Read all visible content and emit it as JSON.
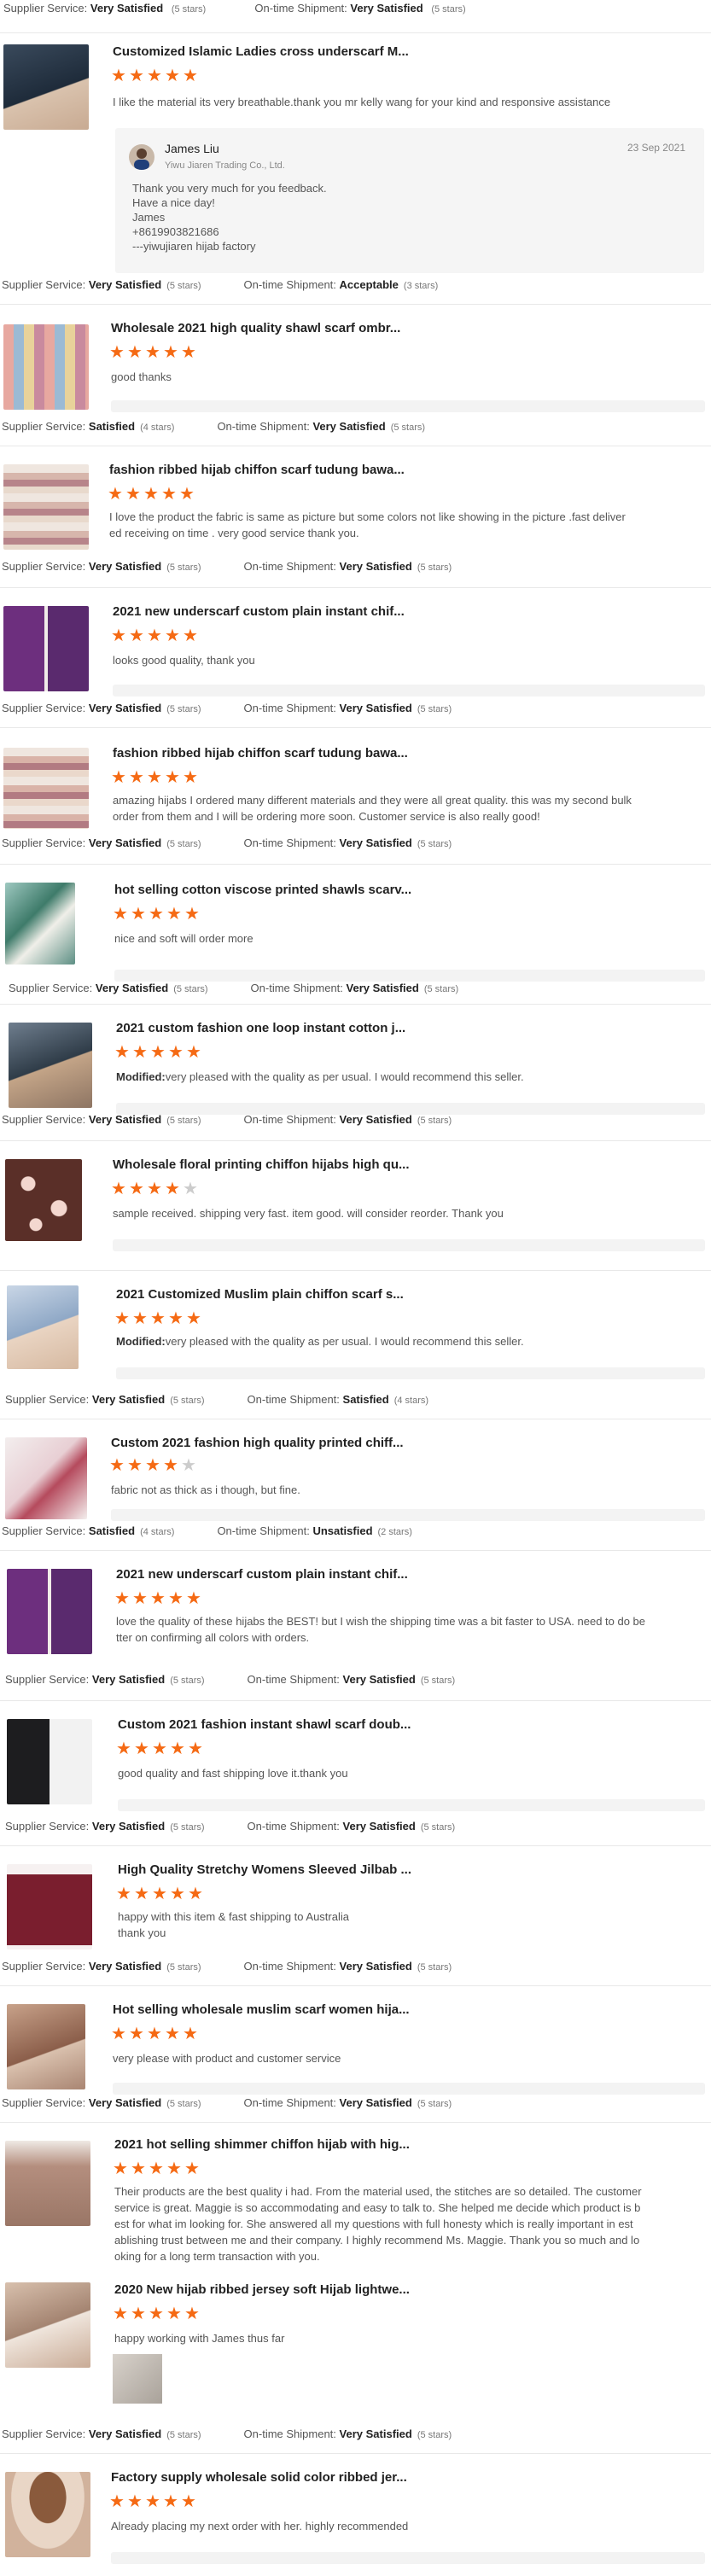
{
  "labels": {
    "supplier": "Supplier Service:",
    "ontime": "On-time Shipment:"
  },
  "colors": {
    "star": "#f56a14",
    "star_off": "#cccccc"
  },
  "top_stats": {
    "supplier_value": "Very Satisfied",
    "supplier_stars": "(5 stars)",
    "ontime_value": "Very Satisfied",
    "ontime_stars": "(5 stars)"
  },
  "reviews": [
    {
      "title": "Customized Islamic Ladies cross underscarf M...",
      "rating": 5,
      "text": "I like the material its very breathable.thank you mr kelly wang for your kind and responsive assistance",
      "reply": {
        "name": "James Liu",
        "company": "Yiwu Jiaren Trading Co., Ltd.",
        "date": "23 Sep 2021",
        "lines": [
          "Thank you very much for you feedback.",
          "Have a nice day!",
          "James",
          "+8619903821686",
          "---yiwujiaren hijab factory"
        ]
      },
      "supplier_value": "Very Satisfied",
      "supplier_stars": "(5 stars)",
      "ontime_value": "Acceptable",
      "ontime_stars": "(3 stars)"
    },
    {
      "title": "Wholesale 2021 high quality shawl scarf ombr...",
      "rating": 5,
      "text": "good thanks",
      "supplier_value": "Satisfied",
      "supplier_stars": "(4 stars)",
      "ontime_value": "Very Satisfied",
      "ontime_stars": "(5 stars)"
    },
    {
      "title": "fashion ribbed hijab chiffon scarf tudung bawa...",
      "rating": 5,
      "text_lines": [
        "I love the product the fabric is same as picture but some colors not  like showing in the picture .fast deliver",
        "ed receiving on time . very good service thank you."
      ],
      "supplier_value": "Very Satisfied",
      "supplier_stars": "(5 stars)",
      "ontime_value": "Very Satisfied",
      "ontime_stars": "(5 stars)"
    },
    {
      "title": "2021 new underscarf custom plain instant chif...",
      "rating": 5,
      "text": "looks good quality, thank you",
      "supplier_value": "Very Satisfied",
      "supplier_stars": "(5 stars)",
      "ontime_value": "Very Satisfied",
      "ontime_stars": "(5 stars)"
    },
    {
      "title": "fashion ribbed hijab chiffon scarf tudung bawa...",
      "rating": 5,
      "text_lines": [
        "amazing hijabs I ordered many different materials and they were all great quality. this was my second bulk",
        "order from them and I will be ordering more soon. Customer service is also really good!"
      ],
      "supplier_value": "Very Satisfied",
      "supplier_stars": "(5 stars)",
      "ontime_value": "Very Satisfied",
      "ontime_stars": "(5 stars)"
    },
    {
      "title": "hot selling cotton viscose printed shawls scarv...",
      "rating": 5,
      "text": "nice and soft will order more",
      "supplier_value": "Very Satisfied",
      "supplier_stars": "(5 stars)",
      "ontime_value": "Very Satisfied",
      "ontime_stars": "(5 stars)"
    },
    {
      "title": "2021 custom fashion one loop instant cotton j...",
      "rating": 5,
      "modified_label": "Modified:",
      "text": "very pleased with the quality as per usual. I would recommend this seller.",
      "supplier_value": "Very Satisfied",
      "supplier_stars": "(5 stars)",
      "ontime_value": "Very Satisfied",
      "ontime_stars": "(5 stars)"
    },
    {
      "title": "Wholesale floral printing chiffon hijabs high qu...",
      "rating": 4,
      "text": "sample received. shipping very fast. item good. will consider reorder. Thank you"
    },
    {
      "title": "2021 Customized Muslim plain chiffon scarf s...",
      "rating": 5,
      "modified_label": "Modified:",
      "text": "very pleased with the quality as per usual. I would recommend this seller.",
      "supplier_value": "Very Satisfied",
      "supplier_stars": "(5 stars)",
      "ontime_value": "Satisfied",
      "ontime_stars": "(4 stars)"
    },
    {
      "title": "Custom 2021 fashion high quality printed chiff...",
      "rating": 4,
      "text": "fabric not as thick as i though, but fine.",
      "supplier_value": "Satisfied",
      "supplier_stars": "(4 stars)",
      "ontime_value": "Unsatisfied",
      "ontime_stars": "(2 stars)"
    },
    {
      "title": "2021 new underscarf custom plain instant chif...",
      "rating": 5,
      "text_lines": [
        "love the quality of these hijabs the BEST! but I wish the shipping time was a bit faster to USA. need to do be",
        "tter on confirming all colors with orders."
      ],
      "supplier_value": "Very Satisfied",
      "supplier_stars": "(5 stars)",
      "ontime_value": "Very Satisfied",
      "ontime_stars": "(5 stars)"
    },
    {
      "title": "Custom 2021 fashion instant shawl scarf doub...",
      "rating": 5,
      "text": "good  quality  and  fast shipping  love it.thank you",
      "supplier_value": "Very Satisfied",
      "supplier_stars": "(5 stars)",
      "ontime_value": "Very Satisfied",
      "ontime_stars": "(5 stars)"
    },
    {
      "title": "High Quality Stretchy Womens Sleeved Jilbab ...",
      "rating": 5,
      "text_lines": [
        "happy with this item & fast shipping to Australia",
        "thank you"
      ],
      "supplier_value": "Very Satisfied",
      "supplier_stars": "(5 stars)",
      "ontime_value": "Very Satisfied",
      "ontime_stars": "(5 stars)"
    },
    {
      "title": "Hot selling wholesale muslim scarf women hija...",
      "rating": 5,
      "text": "very please with product and customer service",
      "supplier_value": "Very Satisfied",
      "supplier_stars": "(5 stars)",
      "ontime_value": "Very Satisfied",
      "ontime_stars": "(5 stars)"
    },
    {
      "title": "2021 hot selling shimmer chiffon hijab with hig...",
      "rating": 5,
      "text_lines": [
        "Their products are the best quality i had. From the material used, the stitches are so detailed. The customer",
        "service is great. Maggie is so accommodating and easy to talk to. She helped me decide which product is b",
        "est for what im looking for. She answered all my questions with full honesty which is really important in est",
        "ablishing trust between me and their company. I highly recommend Ms. Maggie. Thank you so much and lo",
        "oking for a long term transaction with you."
      ]
    },
    {
      "title": "2020 New hijab ribbed jersey soft Hijab lightwe...",
      "rating": 5,
      "text": "happy working with James thus far",
      "supplier_value": "Very Satisfied",
      "supplier_stars": "(5 stars)",
      "ontime_value": "Very Satisfied",
      "ontime_stars": "(5 stars)"
    },
    {
      "title": "Factory supply wholesale solid color ribbed jer...",
      "rating": 5,
      "text": "Already placing my next order with her. highly recommended"
    }
  ]
}
